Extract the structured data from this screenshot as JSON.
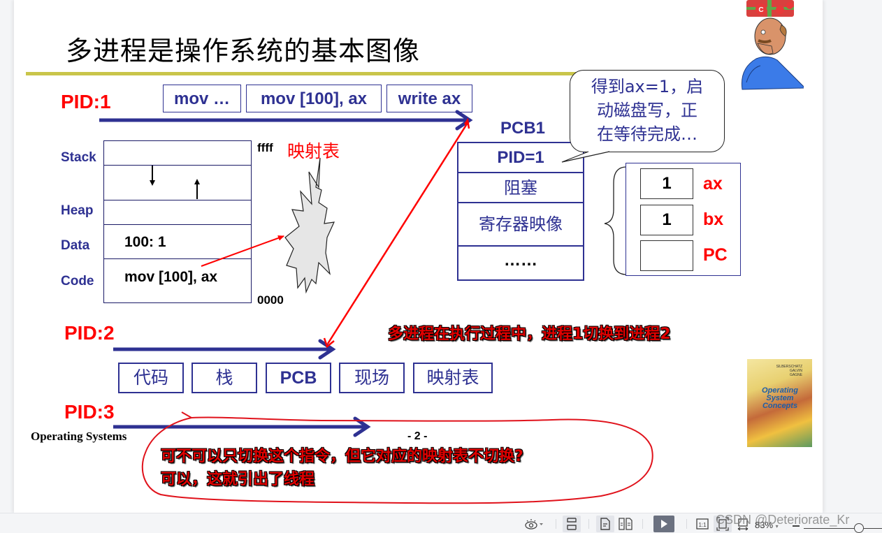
{
  "slide": {
    "title": "多进程是操作系统的基本图像",
    "pid1": {
      "label": "PID:1",
      "instructions": [
        "mov …",
        "mov [100], ax",
        "write ax"
      ]
    },
    "memory": {
      "segment_labels": [
        "Stack",
        "Heap",
        "Data",
        "Code"
      ],
      "data_cell": "100:  1",
      "code_cell": "mov [100], ax",
      "addr_top": "ffff",
      "addr_bottom": "0000"
    },
    "mapping_table_label": "映射表",
    "pcb": {
      "title": "PCB1",
      "rows": [
        "PID=1",
        "阻塞",
        "寄存器映像",
        "……"
      ]
    },
    "speech_bubble": {
      "lines": [
        "得到ax=1，启",
        "动磁盘写，正",
        "在等待完成…"
      ]
    },
    "registers": [
      {
        "value": "1",
        "name": "ax"
      },
      {
        "value": "1",
        "name": "bx"
      },
      {
        "value": "",
        "name": "PC"
      }
    ],
    "pid2": {
      "label": "PID:2",
      "resources": [
        "代码",
        "栈",
        "PCB",
        "现场",
        "映射表"
      ]
    },
    "annotation_switch": "多进程在执行过程中，进程1切换到进程2",
    "pid3": {
      "label": "PID:3"
    },
    "footer": {
      "course": "Operating Systems",
      "page": "- 2 -"
    },
    "annotation_question": {
      "line1": "可不可以只切换这个指令，但它对应的映射表不切换?",
      "line2": "可以，这就引出了线程"
    },
    "book_cover": {
      "title_lines": [
        "Operating",
        "System",
        "Concepts"
      ],
      "authors": [
        "SILBERSCHATZ",
        "GALVIN",
        "GAGNE"
      ]
    },
    "colors": {
      "pid_red": "#ff0000",
      "diagram_blue": "#2e3192",
      "title_rule": "#c9c54a",
      "annotation_red": "#e00000"
    }
  },
  "toolbar": {
    "zoom_level": "83%",
    "icons": [
      "eye-mode-icon",
      "fit-width-icon",
      "single-page-icon",
      "two-page-icon",
      "play-icon",
      "actual-size-icon",
      "fit-page-icon",
      "fit-width-arrows-icon",
      "zoom-out-icon",
      "zoom-slider"
    ]
  },
  "watermark": "CSDN @Deteriorate_Kr"
}
